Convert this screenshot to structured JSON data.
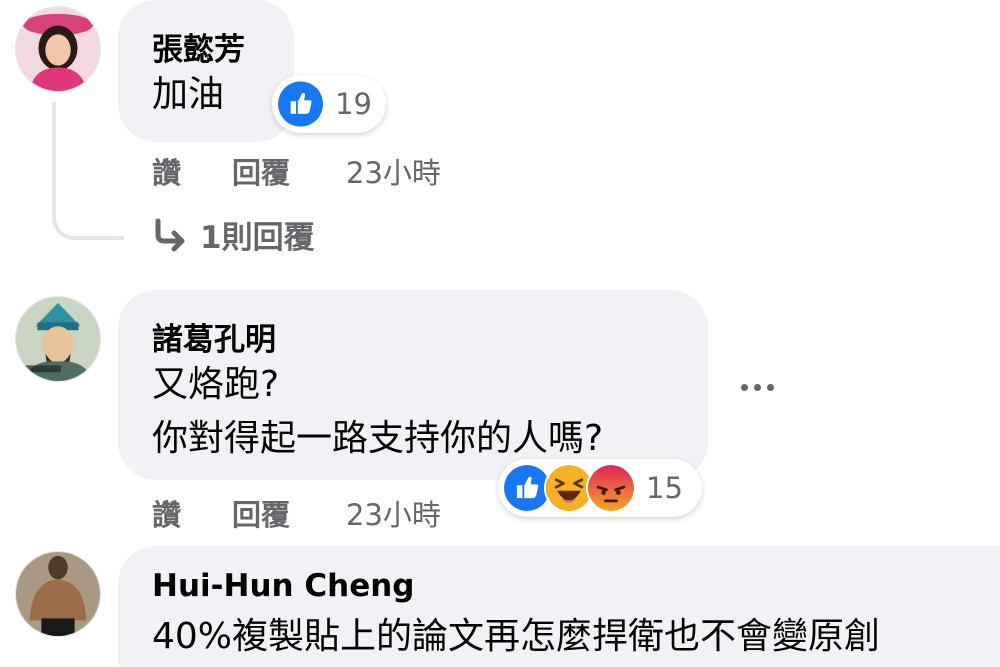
{
  "comments": [
    {
      "author": "張懿芳",
      "lines": [
        "加油"
      ],
      "reactions": {
        "types": [
          "like-icon"
        ],
        "count": "19"
      },
      "actions": {
        "like": "讚",
        "reply": "回覆"
      },
      "time": "23小時",
      "replies_link": "1則回覆"
    },
    {
      "author": "諸葛孔明",
      "lines": [
        "又烙跑?",
        "你對得起一路支持你的人嗎?"
      ],
      "reactions": {
        "types": [
          "like-icon",
          "haha-icon",
          "angry-icon"
        ],
        "count": "15"
      },
      "actions": {
        "like": "讚",
        "reply": "回覆"
      },
      "time": "23小時"
    },
    {
      "author": "Hui-Hun Cheng",
      "lines": [
        "40%複製貼上的論文再怎麼捍衛也不會變原創"
      ]
    }
  ],
  "colors": {
    "bubble": "#f0f2f5",
    "secondary_text": "#65676b",
    "like_blue": "#1877f2",
    "angry_orange": "#e9710f",
    "haha_yellow": "#f7b125"
  }
}
